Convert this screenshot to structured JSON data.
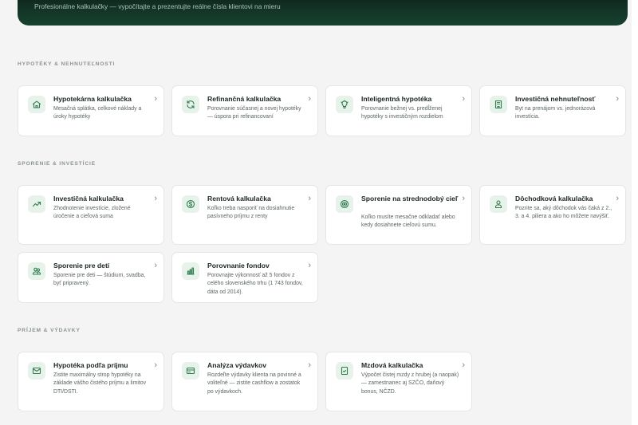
{
  "hero": {
    "subtitle": "Profesionálne kalkulačky — vypočítajte a prezentujte reálne čísla klientovi na mieru"
  },
  "sections": [
    {
      "title": "Hypotéky & nehnuteľnosti",
      "cards": [
        {
          "icon": "home-icon",
          "title": "Hypotekárna kalkulačka",
          "desc": "Mesačná splátka, celkové náklady a úroky hypotéky"
        },
        {
          "icon": "refresh-icon",
          "title": "Refinančná kalkulačka",
          "desc": "Porovnanie súčasnej a novej hypotéky — úspora pri refinancovaní"
        },
        {
          "icon": "lightbulb-icon",
          "title": "Inteligentná hypotéka",
          "desc": "Porovnanie bežnej vs. predĺženej hypotéky s investičným rozdielom"
        },
        {
          "icon": "building-icon",
          "title": "Investičná nehnuteľnosť",
          "desc": "Byt na prenájom vs. jednorázová investícia."
        }
      ]
    },
    {
      "title": "Sporenie & investície",
      "cards": [
        {
          "icon": "trending-up-icon",
          "title": "Investičná kalkulačka",
          "desc": "Zhodnotenie investície, zložené úročenie a cieľová suma"
        },
        {
          "icon": "dollar-circle-icon",
          "title": "Rentová kalkulačka",
          "desc": "Koľko treba nasporiť na dosiahnutie pasívneho príjmu z renty"
        },
        {
          "icon": "target-icon",
          "title": "Sporenie na strednodobý cieľ",
          "desc": "Koľko musíte mesačne odkladať alebo kedy dosiahnete cieľovú sumu."
        },
        {
          "icon": "user-icon",
          "title": "Dôchodková kalkulačka",
          "desc": "Pozrite sa, aký dôchodok vás čaká z 2., 3. a 4. piliera a ako ho môžete navýšiť."
        },
        {
          "icon": "users-icon",
          "title": "Sporenie pre deti",
          "desc": "Sporenie pre deti — štúdium, svadba, byť pripravený."
        },
        {
          "icon": "bar-chart-icon",
          "title": "Porovnanie fondov",
          "desc": "Porovnajte výkonnosť až 5 fondov z celého slovenského trhu (1 743 fondov, dáta od 2014)."
        }
      ]
    },
    {
      "title": "Príjem & výdavky",
      "cards": [
        {
          "icon": "mail-icon",
          "title": "Hypotéka podľa príjmu",
          "desc": "Zistite maximálny strop hypotéky na základe vášho čistého príjmu a limitov DTI/DSTI."
        },
        {
          "icon": "credit-card-icon",
          "title": "Analýza výdavkov",
          "desc": "Rozdeľte výdavky klienta na povinné a voliteľné — zistite cashflow a zostatok po výdavkoch."
        },
        {
          "icon": "document-icon",
          "title": "Mzdová kalkulačka",
          "desc": "Výpočet čistej mzdy z hrubej (a naopak) — zamestnanec aj SZČO, daňový bonus, NČZD."
        }
      ]
    }
  ],
  "chevron": "›",
  "colors": {
    "accent": "#2f7d4f",
    "icon_bg": "#e6f2ea",
    "hero": "#14372a"
  }
}
